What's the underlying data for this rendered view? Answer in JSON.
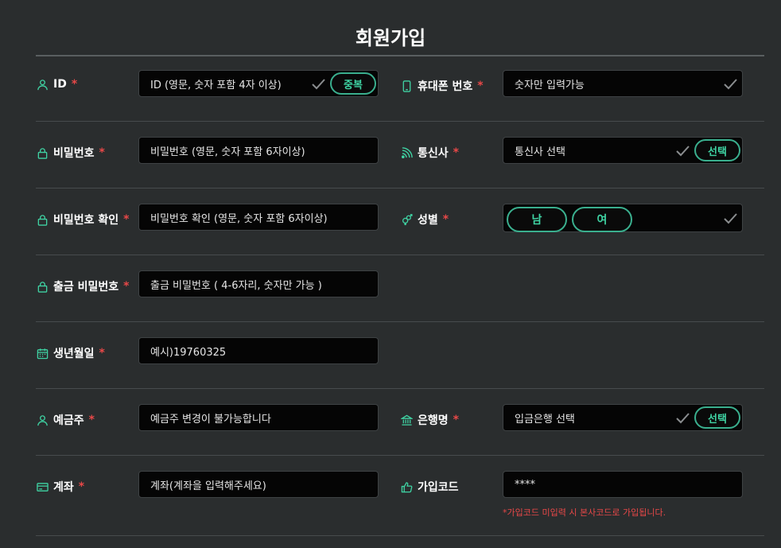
{
  "page": {
    "title": "회원가입"
  },
  "required_mark": "*",
  "fields": {
    "id": {
      "label": "ID",
      "placeholder": "ID (영문, 숫자 포함 4자 이상)",
      "button": "중복"
    },
    "phone": {
      "label": "휴대폰 번호",
      "placeholder": "숫자만 입력가능"
    },
    "password": {
      "label": "비밀번호",
      "placeholder": "비밀번호 (영문, 숫자 포함 6자이상)"
    },
    "carrier": {
      "label": "통신사",
      "placeholder": "통신사 선택",
      "button": "선택"
    },
    "password_confirm": {
      "label": "비밀번호 확인",
      "placeholder": "비밀번호 확인 (영문, 숫자 포함 6자이상)"
    },
    "gender": {
      "label": "성별",
      "options": [
        "남",
        "여"
      ]
    },
    "withdraw_password": {
      "label": "출금 비밀번호",
      "placeholder": "출금 비밀번호 ( 4-6자리, 숫자만 가능 )"
    },
    "birthdate": {
      "label": "생년월일",
      "placeholder": "예시)19760325"
    },
    "depositor": {
      "label": "예금주",
      "placeholder": "예금주 변경이 불가능합니다"
    },
    "bank": {
      "label": "은행명",
      "placeholder": "입금은행 선택",
      "button": "선택"
    },
    "account": {
      "label": "계좌",
      "placeholder": "계좌(계좌을 입력해주세요)"
    },
    "signup_code": {
      "label": "가입코드",
      "value": "****",
      "note": "*가입코드 미입력 시 본사코드로 가입됩니다."
    }
  },
  "colors": {
    "accent": "#3fd3a3",
    "required": "#e84848",
    "background": "#2a2d2e",
    "input_bg": "#050505"
  }
}
